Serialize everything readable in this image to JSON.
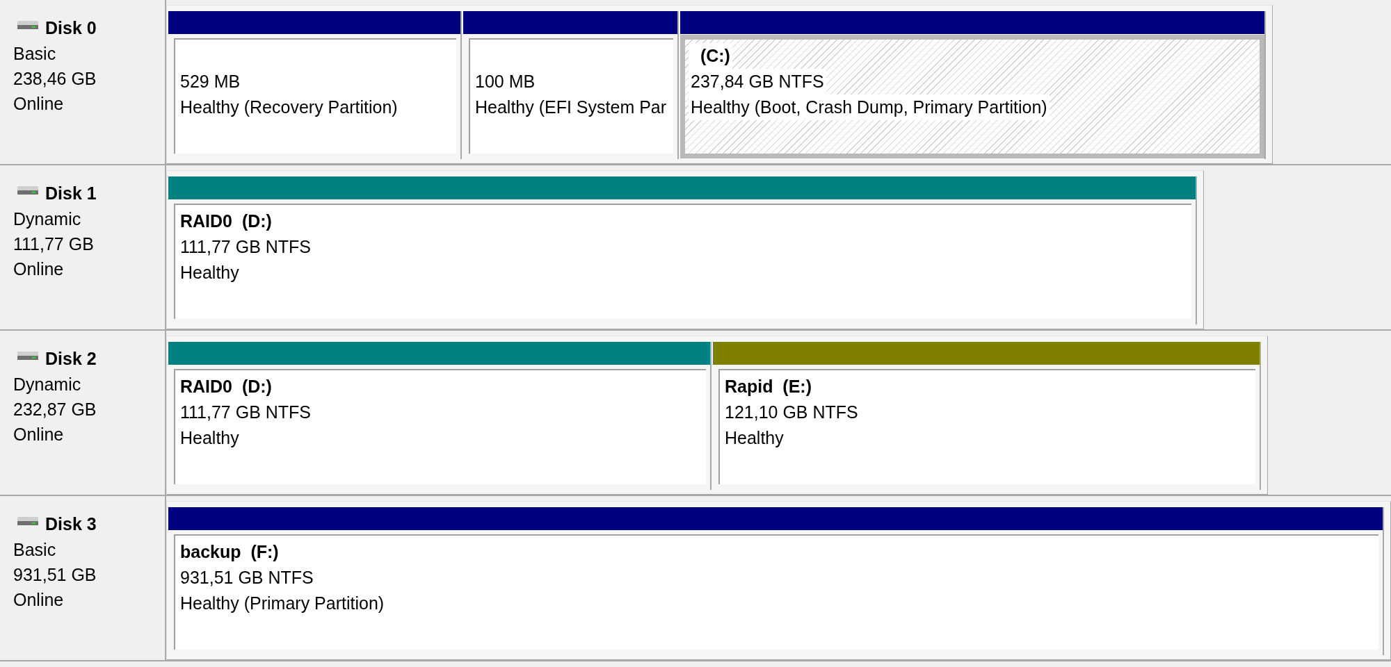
{
  "disks": [
    {
      "name": "Disk 0",
      "type": "Basic",
      "size": "238,46 GB",
      "status": "Online",
      "partitions": [
        {
          "size": "529 MB",
          "status": "Healthy (Recovery Partition)",
          "color": "#000080",
          "selected": false
        },
        {
          "size": "100 MB",
          "status": "Healthy (EFI System Par",
          "color": "#000080",
          "selected": false
        },
        {
          "drive": "(C:)",
          "size": "237,84 GB NTFS",
          "status": "Healthy (Boot, Crash Dump, Primary Partition)",
          "color": "#000080",
          "selected": true
        }
      ]
    },
    {
      "name": "Disk 1",
      "type": "Dynamic",
      "size": "111,77 GB",
      "status": "Online",
      "partitions": [
        {
          "name": "RAID0",
          "drive": "(D:)",
          "size": "111,77 GB NTFS",
          "status": "Healthy",
          "color": "#008080",
          "selected": false
        }
      ]
    },
    {
      "name": "Disk 2",
      "type": "Dynamic",
      "size": "232,87 GB",
      "status": "Online",
      "partitions": [
        {
          "name": "RAID0",
          "drive": "(D:)",
          "size": "111,77 GB NTFS",
          "status": "Healthy",
          "color": "#008080",
          "selected": false
        },
        {
          "name": "Rapid",
          "drive": "(E:)",
          "size": "121,10 GB NTFS",
          "status": "Healthy",
          "color": "#808000",
          "selected": false
        }
      ]
    },
    {
      "name": "Disk 3",
      "type": "Basic",
      "size": "931,51 GB",
      "status": "Online",
      "partitions": [
        {
          "name": "backup",
          "drive": "(F:)",
          "size": "931,51 GB NTFS",
          "status": "Healthy (Primary Partition)",
          "color": "#000080",
          "selected": false
        }
      ]
    }
  ]
}
